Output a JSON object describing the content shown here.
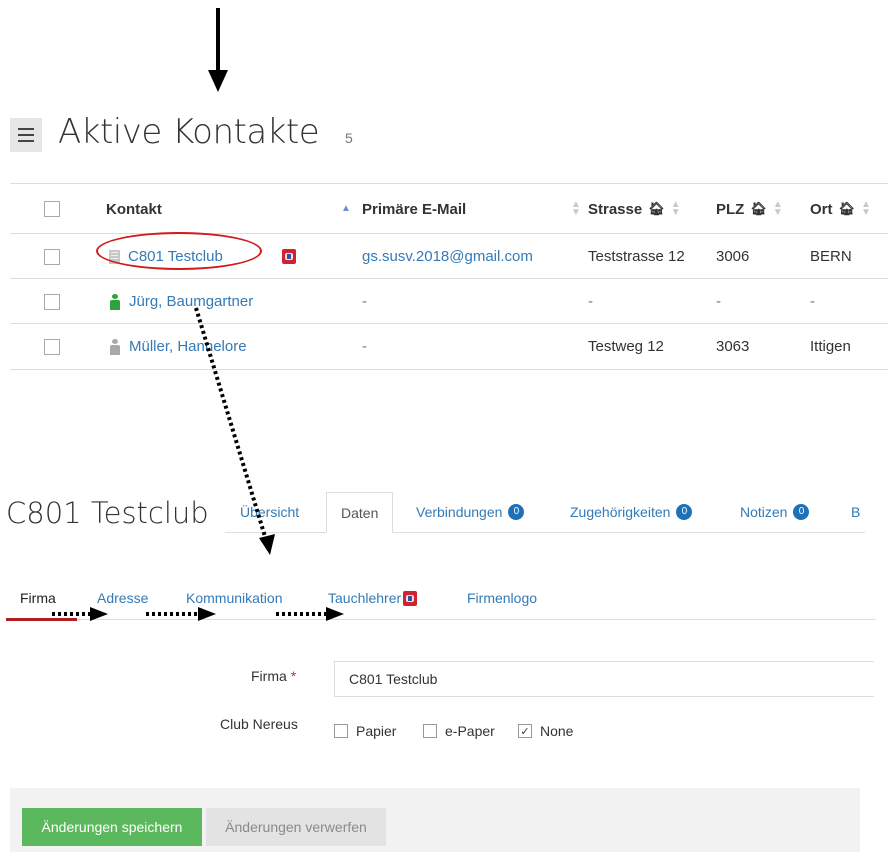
{
  "list": {
    "title": "Aktive Kontakte",
    "count": "5",
    "columns": [
      "Kontakt",
      "Primäre E-Mail",
      "Strasse",
      "PLZ",
      "Ort"
    ],
    "rows": [
      {
        "name": "C801 Testclub",
        "type": "firm",
        "email": "gs.susv.2018@gmail.com",
        "street": "Teststrasse 12",
        "plz": "3006",
        "city": "BERN"
      },
      {
        "name": "Jürg, Baumgartner",
        "type": "person-male",
        "email": "-",
        "street": "-",
        "plz": "-",
        "city": "-"
      },
      {
        "name": "Müller, Hannelore",
        "type": "person-female",
        "email": "-",
        "street": "Testweg 12",
        "plz": "3063",
        "city": "Ittigen"
      }
    ]
  },
  "detail": {
    "title": "C801 Testclub",
    "tabs": [
      {
        "label": "Übersicht"
      },
      {
        "label": "Daten"
      },
      {
        "label": "Verbindungen",
        "count": "0"
      },
      {
        "label": "Zugehörigkeiten",
        "count": "0"
      },
      {
        "label": "Notizen",
        "count": "0"
      },
      {
        "label": "B"
      }
    ],
    "subtabs": [
      "Firma",
      "Adresse",
      "Kommunikation",
      "Tauchlehrer",
      "Firmenlogo"
    ],
    "form": {
      "firma_label": "Firma",
      "required_mark": "*",
      "firma_value": "C801 Testclub",
      "club_label": "Club Nereus",
      "options": [
        {
          "label": "Papier",
          "checked": false
        },
        {
          "label": "e-Paper",
          "checked": false
        },
        {
          "label": "None",
          "checked": true
        }
      ]
    },
    "buttons": {
      "save": "Änderungen speichern",
      "discard": "Änderungen verwerfen"
    }
  },
  "colors": {
    "link": "#337ab7",
    "annotation": "#d11a1a",
    "save": "#5cb85c",
    "badge": "#1e71b6"
  },
  "icons": [
    "menu-icon",
    "building-icon",
    "person-icon",
    "club-badge-icon",
    "house-icon",
    "sort-icon"
  ]
}
